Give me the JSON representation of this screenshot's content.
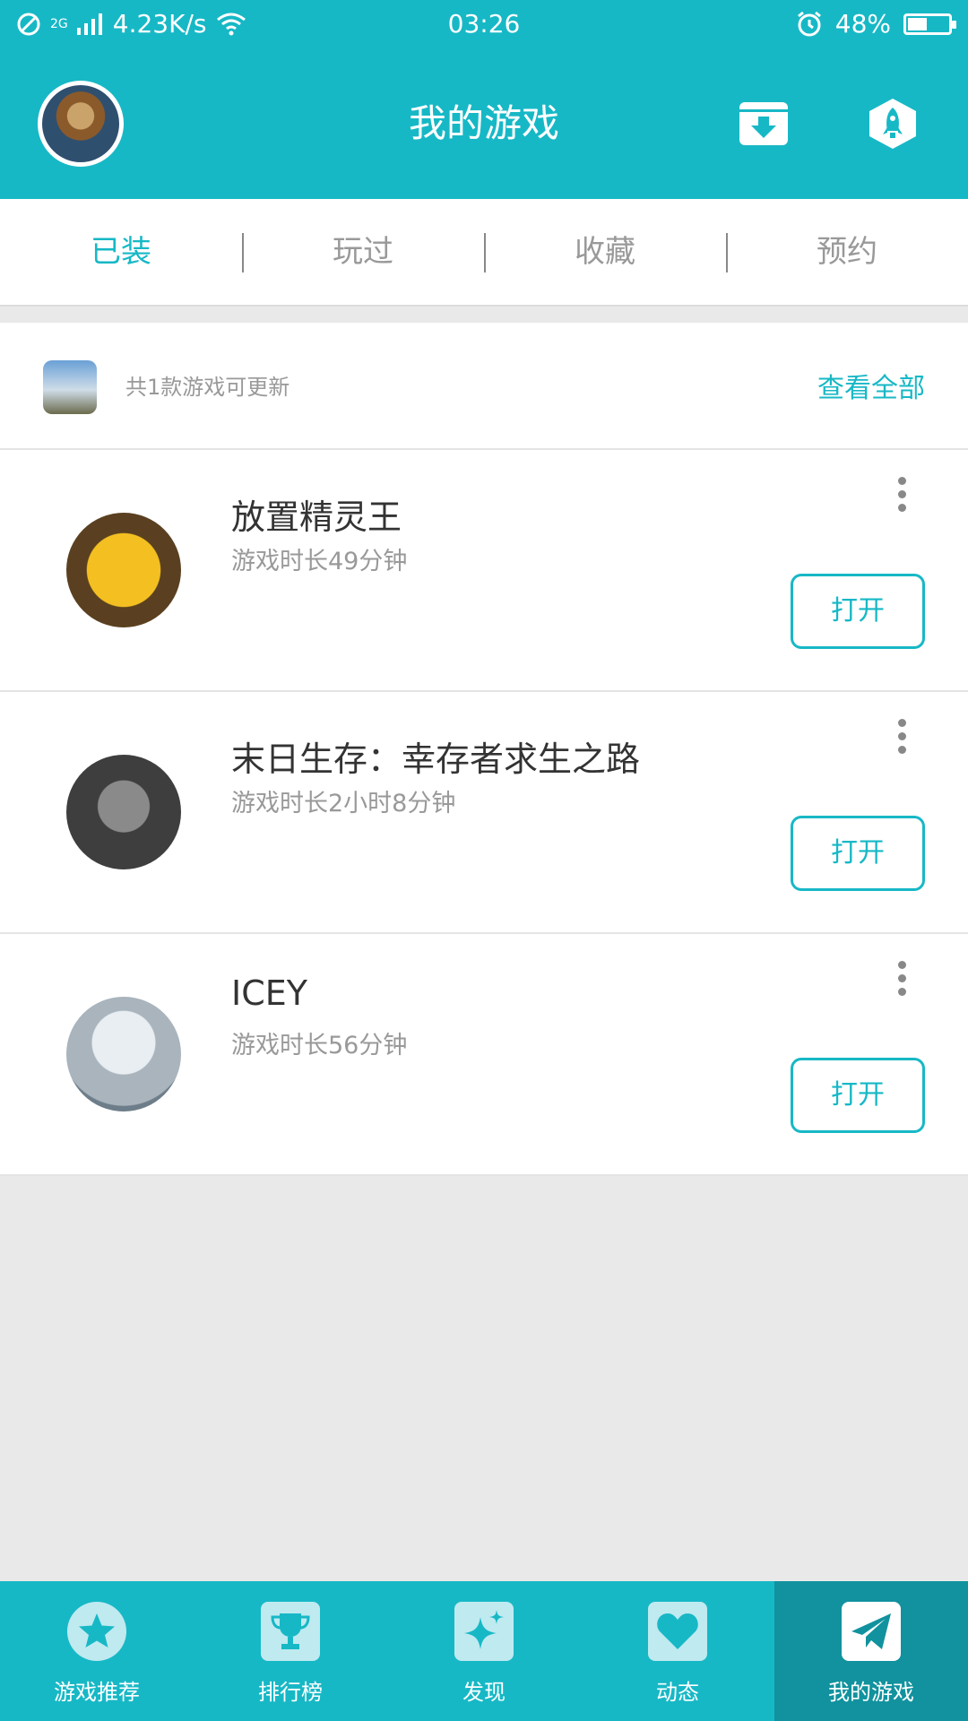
{
  "status_bar": {
    "network": "2G",
    "speed": "4.23K/s",
    "time": "03:26",
    "battery": "48%",
    "battery_level": 0.48
  },
  "header": {
    "title": "我的游戏"
  },
  "tabs": [
    {
      "label": "已装",
      "active": true
    },
    {
      "label": "玩过",
      "active": false
    },
    {
      "label": "收藏",
      "active": false
    },
    {
      "label": "预约",
      "active": false
    }
  ],
  "update_banner": {
    "text": "共1款游戏可更新",
    "view_all": "查看全部"
  },
  "games": [
    {
      "name": "放置精灵王",
      "playtime": "游戏时长49分钟",
      "action": "打开"
    },
    {
      "name": "末日生存：幸存者求生之路",
      "playtime": "游戏时长2小时8分钟",
      "action": "打开"
    },
    {
      "name": "ICEY",
      "playtime": "游戏时长56分钟",
      "action": "打开"
    }
  ],
  "bottom_nav": [
    {
      "label": "游戏推荐",
      "icon": "star-icon",
      "active": false
    },
    {
      "label": "排行榜",
      "icon": "trophy-icon",
      "active": false
    },
    {
      "label": "发现",
      "icon": "sparkle-icon",
      "active": false
    },
    {
      "label": "动态",
      "icon": "heart-icon",
      "active": false
    },
    {
      "label": "我的游戏",
      "icon": "paper-plane-icon",
      "active": true
    }
  ],
  "colors": {
    "accent": "#17b8c6",
    "nav_active": "#11929e",
    "background": "#e9e9e9"
  }
}
